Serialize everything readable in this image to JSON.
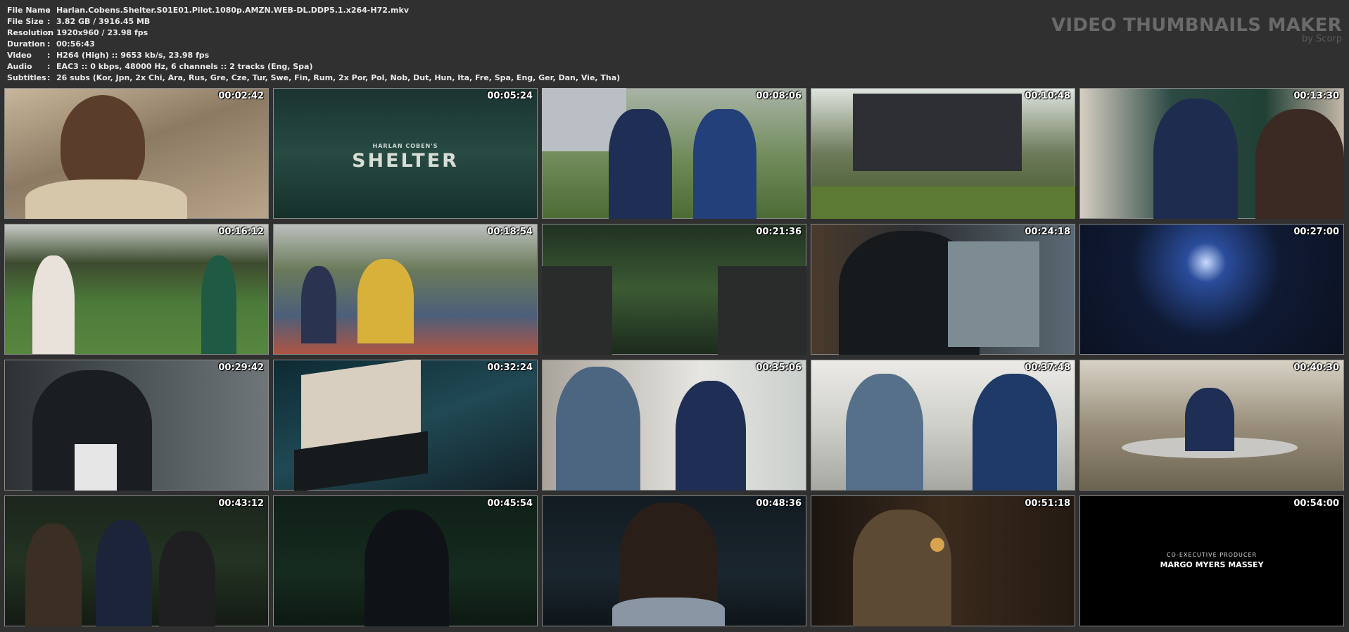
{
  "info": [
    {
      "key": "File Name",
      "value": "Harlan.Cobens.Shelter.S01E01.Pilot.1080p.AMZN.WEB-DL.DDP5.1.x264-H72.mkv"
    },
    {
      "key": "File Size",
      "value": "3.82 GB  / 3916.45 MB"
    },
    {
      "key": "Resolution",
      "value": "1920x960 / 23.98 fps"
    },
    {
      "key": "Duration",
      "value": "00:56:43"
    },
    {
      "key": "Video",
      "value": "H264 (High) :: 9653 kb/s, 23.98 fps"
    },
    {
      "key": "Audio",
      "value": "EAC3 :: 0 kbps, 48000 Hz, 6 channels :: 2 tracks (Eng, Spa)"
    },
    {
      "key": "Subtitles",
      "value": "26 subs (Kor, Jpn, 2x Chi, Ara, Rus, Gre, Cze, Tur, Swe, Fin, Rum, 2x Por, Pol, Nob, Dut, Hun, Ita, Fre, Spa, Eng, Ger, Dan, Vie, Tha)"
    }
  ],
  "separator": ":",
  "brand": {
    "title": "VIDEO THUMBNAILS MAKER",
    "subtitle": "by Scorp"
  },
  "thumbnails": [
    {
      "time": "00:02:42"
    },
    {
      "time": "00:05:24"
    },
    {
      "time": "00:08:06"
    },
    {
      "time": "00:10:48"
    },
    {
      "time": "00:13:30"
    },
    {
      "time": "00:16:12"
    },
    {
      "time": "00:18:54"
    },
    {
      "time": "00:21:36"
    },
    {
      "time": "00:24:18"
    },
    {
      "time": "00:27:00"
    },
    {
      "time": "00:29:42"
    },
    {
      "time": "00:32:24"
    },
    {
      "time": "00:35:06"
    },
    {
      "time": "00:37:48"
    },
    {
      "time": "00:40:30"
    },
    {
      "time": "00:43:12"
    },
    {
      "time": "00:45:54"
    },
    {
      "time": "00:48:36"
    },
    {
      "time": "00:51:18"
    },
    {
      "time": "00:54:00"
    }
  ],
  "title_card": {
    "small": "HARLAN COBEN'S",
    "big": "SHELTER"
  },
  "credit": {
    "role": "CO-EXECUTIVE PRODUCER",
    "name": "MARGO MYERS MASSEY"
  }
}
